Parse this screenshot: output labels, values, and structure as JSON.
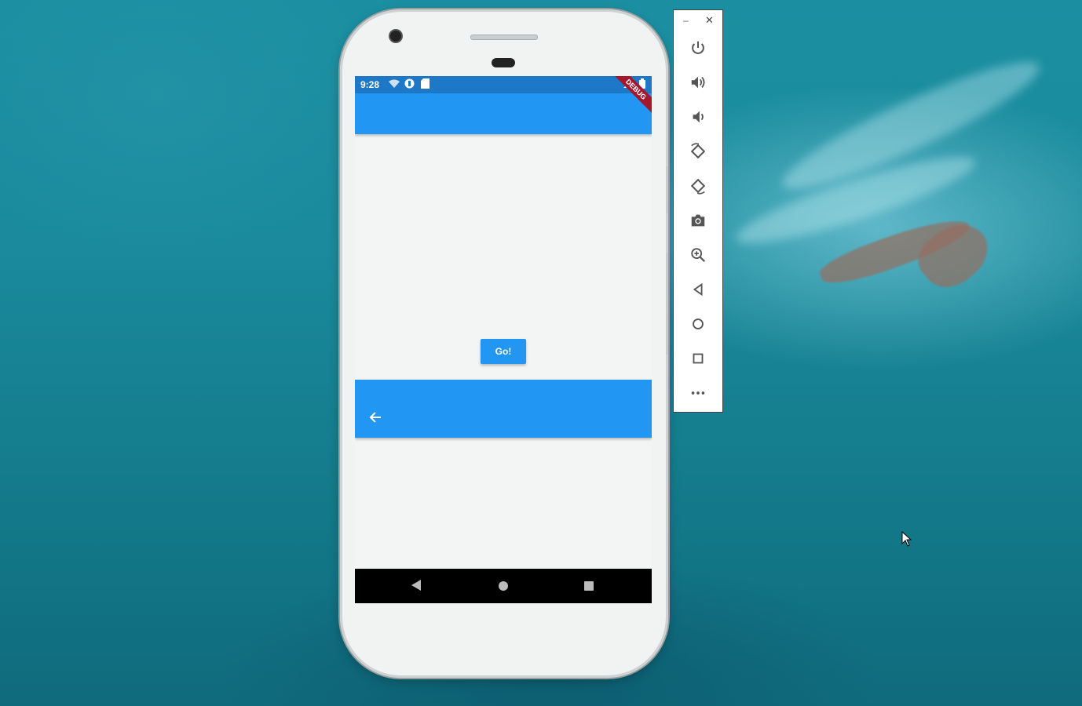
{
  "status_bar": {
    "time": "9:28"
  },
  "debug_banner": {
    "label": "DEBUG"
  },
  "main_button": {
    "label": "Go!"
  },
  "colors": {
    "app_primary": "#2196f3",
    "status_bar": "#1e78c8",
    "debug_banner": "#a5182c",
    "screen_bg": "#f3f5f5"
  },
  "emulator_toolbar": {
    "items": [
      "power-icon",
      "volume-up-icon",
      "volume-down-icon",
      "rotate-left-icon",
      "rotate-right-icon",
      "camera-icon",
      "zoom-icon",
      "back-icon",
      "home-icon",
      "overview-icon",
      "more-icon"
    ]
  },
  "android_nav": {
    "items": [
      "nav-back-icon",
      "nav-home-icon",
      "nav-recents-icon"
    ]
  }
}
